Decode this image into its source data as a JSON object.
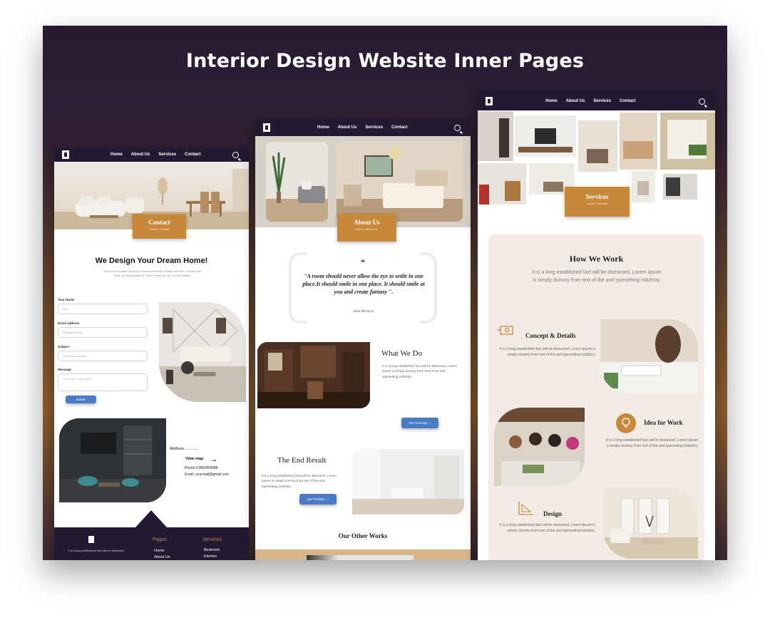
{
  "title": "Interior Design Website Inner Pages",
  "nav": {
    "home": "Home",
    "about": "About Us",
    "services": "Services",
    "contact": "Contact"
  },
  "contact_page": {
    "hero_badge": {
      "title": "Contact",
      "crumb": "Home / Contact"
    },
    "heading": "We Design Your Dream Home!",
    "intro": "For More Information About Our Products & Services Please Feel Free To Drop Us An Email. Our Staff Always Be There To Help You Out. Do Not Hesitate.",
    "form": {
      "name_label": "Your Name",
      "name_placeholder": "Bob",
      "email_label": "Email address",
      "email_placeholder": "Bb@gmail.com",
      "subject_label": "Subject",
      "subject_placeholder": "This is an example",
      "message_label": "Message",
      "message_placeholder": "Hi, I'd like to ask about",
      "submit": "Submit"
    },
    "address_label": "Address.............",
    "view_map": "View map",
    "phone": "Phone:01883428488",
    "email": "Email: yourmail@gmail.com",
    "footer": {
      "blurb": "It is a long established fact will be distracted.",
      "pages_title": "Pages",
      "pages": [
        "Home",
        "About Us"
      ],
      "services_title": "Services",
      "services": [
        "Bedroom",
        "Kitchen"
      ]
    }
  },
  "about_page": {
    "hero_badge": {
      "title": "About Us",
      "crumb": "Home / About Us"
    },
    "quote": "\"A room should never allow the eye to settle in one place.It should smile in one place. It should smile at you and create fantasy \".",
    "quote_mark": "❝",
    "quote_author": "-Juan Montoya",
    "what_we_do": {
      "title": "What We Do",
      "text": "It is a long established fact will be distracted. Lorem Ipsum is simply dummy from text of the and typesetting indufstry.",
      "button": "Our Concept →"
    },
    "end_result": {
      "title": "The End Result",
      "text": "It is a long established fact will be distracted. Lorem Ipsum is simply dummy from text of the and typesetting indufstry.",
      "button": "Our Portfolio →"
    },
    "other_works": "Our Other Works"
  },
  "services_page": {
    "hero_badge": {
      "title": "Services",
      "crumb": "Home / Services"
    },
    "how_we_work": {
      "title": "How We Work",
      "text": "It is a long established fact will be distracted. Lorem Ipsum is simply dummy from text of the and typesetting indufstry."
    },
    "concept": {
      "title": "Concept & Details",
      "text": "It is a long established fact will be distracted. Lorem Ipsum is simply dummy from text of the and typesetting indufstry."
    },
    "idea": {
      "title": "Idea for Work",
      "text": "It is a long established fact will be distracted. Lorem Ipsum is simply dummy from text of the and typesetting indufstry."
    },
    "design": {
      "title": "Design",
      "text": "It is a long established fact will be distracted. Lorem Ipsum is simply dummy from text of the and typesetting indufstry."
    }
  },
  "colors": {
    "nav": "#221a32",
    "accent": "#c8883a",
    "button": "#4b7bc4",
    "panel": "#f3ece6"
  }
}
